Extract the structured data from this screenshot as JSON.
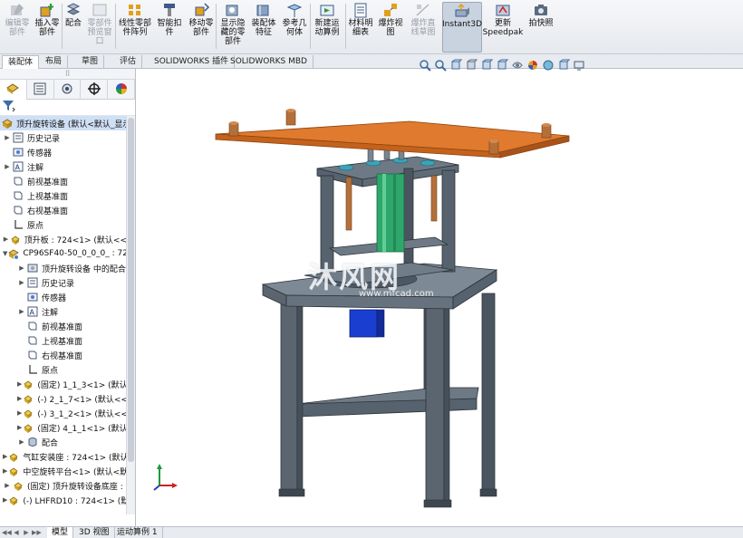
{
  "ribbon": {
    "buttons": [
      {
        "label": "编辑零\n部件",
        "icon": "edit-part-icon",
        "disabled": true
      },
      {
        "label": "插入零\n部件",
        "icon": "insert-component-icon",
        "disabled": false
      },
      {
        "label": "配合",
        "icon": "mate-icon",
        "disabled": false
      },
      {
        "label": "零部件\n预览窗\n口",
        "icon": "component-preview-icon",
        "disabled": true
      },
      {
        "label": "线性零部\n件阵列",
        "icon": "linear-pattern-icon",
        "disabled": false
      },
      {
        "label": "智能扣\n件",
        "icon": "smart-fasteners-icon",
        "disabled": false
      },
      {
        "label": "移动零\n部件",
        "icon": "move-component-icon",
        "disabled": false
      },
      {
        "label": "显示隐\n藏的零\n部件",
        "icon": "show-hidden-icon",
        "disabled": false
      },
      {
        "label": "装配体\n特征",
        "icon": "assembly-features-icon",
        "disabled": false
      },
      {
        "label": "参考几\n何体",
        "icon": "reference-geometry-icon",
        "disabled": false
      },
      {
        "label": "新建运\n动算例",
        "icon": "motion-study-icon",
        "disabled": false
      },
      {
        "label": "材料明\n细表",
        "icon": "bom-icon",
        "disabled": false
      },
      {
        "label": "爆炸视\n图",
        "icon": "exploded-view-icon",
        "disabled": false
      },
      {
        "label": "爆炸直\n线草图",
        "icon": "explode-line-sketch-icon",
        "disabled": true
      },
      {
        "label": "Instant3D",
        "icon": "instant3d-icon",
        "disabled": false,
        "active": true
      },
      {
        "label": "更新\nSpeedpak",
        "icon": "speedpak-icon",
        "disabled": false
      },
      {
        "label": "拍快照",
        "icon": "snapshot-icon",
        "disabled": false
      }
    ]
  },
  "command_tabs": [
    "装配体",
    "布局",
    "草图",
    "评估",
    "SOLIDWORKS 插件",
    "SOLIDWORKS MBD"
  ],
  "left_panel": {
    "grip": "⠿",
    "tabs": [
      "featuremanager-icon",
      "propertymanager-icon",
      "configurationmanager-icon",
      "dimxpert-icon",
      "display-manager-icon"
    ],
    "tree": [
      {
        "text": "顶升旋转设备 (默认<默认_显示",
        "icon": "assembly-icon",
        "exp": "",
        "level": 0,
        "selected": true
      },
      {
        "text": "历史记录",
        "icon": "history-icon",
        "exp": "▶",
        "level": 1
      },
      {
        "text": "传感器",
        "icon": "sensor-icon",
        "exp": "",
        "level": 1
      },
      {
        "text": "注解",
        "icon": "annotation-icon",
        "exp": "▶",
        "level": 1
      },
      {
        "text": "前视基准面",
        "icon": "plane-icon",
        "exp": "",
        "level": 1
      },
      {
        "text": "上视基准面",
        "icon": "plane-icon",
        "exp": "",
        "level": 1
      },
      {
        "text": "右视基准面",
        "icon": "plane-icon",
        "exp": "",
        "level": 1
      },
      {
        "text": "原点",
        "icon": "origin-icon",
        "exp": "",
        "level": 1
      },
      {
        "text": "顶升板 : 724<1> (默认<<",
        "icon": "part-icon",
        "exp": "▶",
        "level": 1
      },
      {
        "text": "CP96SF40-50_0_0_0_ : 72",
        "icon": "subassembly-icon",
        "exp": "▼",
        "level": 1
      },
      {
        "text": "顶升旋转设备 中的配合",
        "icon": "mate-folder-icon",
        "exp": "▶",
        "level": 2
      },
      {
        "text": "历史记录",
        "icon": "history-icon",
        "exp": "▶",
        "level": 2
      },
      {
        "text": "传感器",
        "icon": "sensor-icon",
        "exp": "",
        "level": 2
      },
      {
        "text": "注解",
        "icon": "annotation-icon",
        "exp": "▶",
        "level": 2
      },
      {
        "text": "前视基准面",
        "icon": "plane-icon",
        "exp": "",
        "level": 2
      },
      {
        "text": "上视基准面",
        "icon": "plane-icon",
        "exp": "",
        "level": 2
      },
      {
        "text": "右视基准面",
        "icon": "plane-icon",
        "exp": "",
        "level": 2
      },
      {
        "text": "原点",
        "icon": "origin-icon",
        "exp": "",
        "level": 2
      },
      {
        "text": "(固定) 1_1_3<1> (默认<",
        "icon": "part-icon",
        "exp": "▶",
        "level": 2
      },
      {
        "text": "(-) 2_1_7<1> (默认<<默",
        "icon": "part-icon",
        "exp": "▶",
        "level": 2
      },
      {
        "text": "(-) 3_1_2<1> (默认<<默",
        "icon": "part-icon",
        "exp": "▶",
        "level": 2
      },
      {
        "text": "(固定) 4_1_1<1> (默认",
        "icon": "part-icon",
        "exp": "▶",
        "level": 2
      },
      {
        "text": "配合",
        "icon": "mates-icon",
        "exp": "▶",
        "level": 2
      },
      {
        "text": "气缸安装座 : 724<1> (默认",
        "icon": "part-icon",
        "exp": "▶",
        "level": 1
      },
      {
        "text": "中空旋转平台<1> (默认<默",
        "icon": "part-icon",
        "exp": "▶",
        "level": 1
      },
      {
        "text": "(固定) 顶升旋转设备底座 :",
        "icon": "part-icon",
        "exp": "▶",
        "level": 1
      },
      {
        "text": "(-) LHFRD10 : 724<1> (默",
        "icon": "part-icon",
        "exp": "▶",
        "level": 1
      }
    ]
  },
  "bottom_tabs": [
    "模型",
    "3D 视图",
    "运动算例 1"
  ],
  "bottom_nav": [
    "◀◀",
    "◀",
    "▶",
    "▶▶"
  ],
  "viewport": {
    "heads_up_icons": [
      "zoom-to-fit-icon",
      "zoom-area-icon",
      "previous-view-icon",
      "section-view-icon",
      "view-orientation-icon",
      "display-style-icon",
      "hide-show-icon",
      "edit-appearance-icon",
      "apply-scene-icon",
      "view-settings-icon",
      "display-monitor-icon"
    ],
    "watermark": "沐风网",
    "watermark_url": "www.mfcad.com",
    "colors": {
      "top_plate": "#e07a2e",
      "frame": "#5f6c78",
      "motor": "#1a3fd0",
      "cylinder": "#2fa66c",
      "rod": "#b5703a",
      "flange": "#3aa4b8"
    }
  }
}
